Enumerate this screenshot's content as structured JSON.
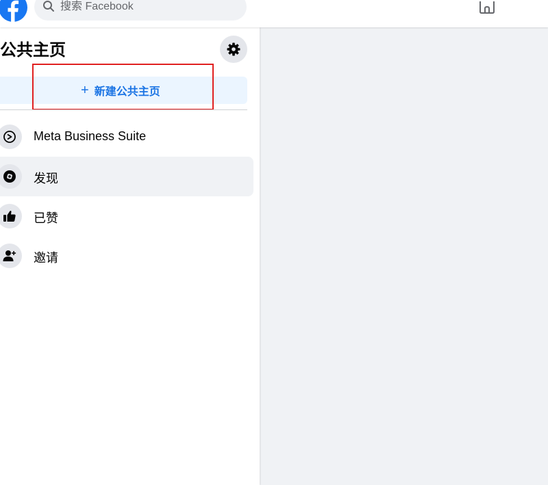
{
  "header": {
    "search": {
      "placeholder": "搜索 Facebook",
      "value": ""
    }
  },
  "sidebar": {
    "title": "公共主页",
    "create_button_label": "新建公共主页",
    "create_button_plus": "+",
    "nav_items": [
      {
        "label": "Meta Business Suite",
        "icon": "meta-business-suite-icon",
        "active": false
      },
      {
        "label": "发现",
        "icon": "compass-icon",
        "active": true
      },
      {
        "label": "已赞",
        "icon": "thumbs-up-icon",
        "active": false
      },
      {
        "label": "邀请",
        "icon": "add-person-icon",
        "active": false
      }
    ]
  },
  "colors": {
    "brand_blue": "#1877f2",
    "link_blue": "#1b74e4",
    "highlight_red": "#e02020",
    "page_background": "#f0f2f5"
  }
}
